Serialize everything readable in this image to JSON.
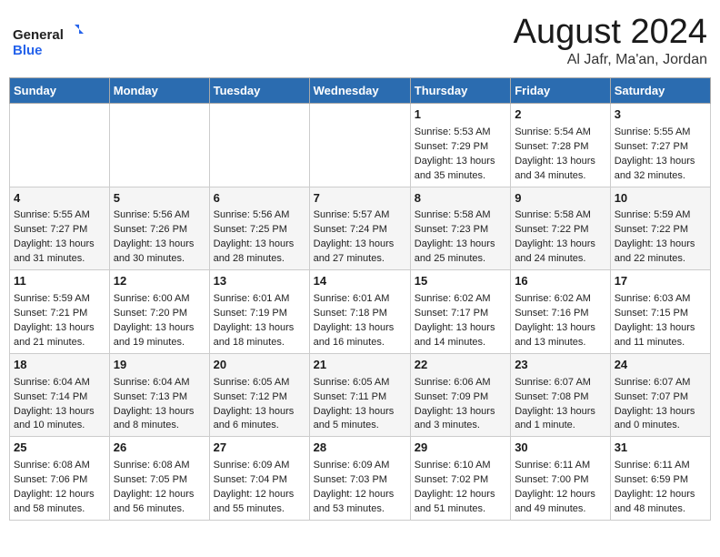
{
  "header": {
    "logo_line1": "General",
    "logo_line2": "Blue",
    "month_year": "August 2024",
    "location": "Al Jafr, Ma'an, Jordan"
  },
  "weekdays": [
    "Sunday",
    "Monday",
    "Tuesday",
    "Wednesday",
    "Thursday",
    "Friday",
    "Saturday"
  ],
  "weeks": [
    [
      {
        "day": "",
        "lines": []
      },
      {
        "day": "",
        "lines": []
      },
      {
        "day": "",
        "lines": []
      },
      {
        "day": "",
        "lines": []
      },
      {
        "day": "1",
        "lines": [
          "Sunrise: 5:53 AM",
          "Sunset: 7:29 PM",
          "Daylight: 13 hours",
          "and 35 minutes."
        ]
      },
      {
        "day": "2",
        "lines": [
          "Sunrise: 5:54 AM",
          "Sunset: 7:28 PM",
          "Daylight: 13 hours",
          "and 34 minutes."
        ]
      },
      {
        "day": "3",
        "lines": [
          "Sunrise: 5:55 AM",
          "Sunset: 7:27 PM",
          "Daylight: 13 hours",
          "and 32 minutes."
        ]
      }
    ],
    [
      {
        "day": "4",
        "lines": [
          "Sunrise: 5:55 AM",
          "Sunset: 7:27 PM",
          "Daylight: 13 hours",
          "and 31 minutes."
        ]
      },
      {
        "day": "5",
        "lines": [
          "Sunrise: 5:56 AM",
          "Sunset: 7:26 PM",
          "Daylight: 13 hours",
          "and 30 minutes."
        ]
      },
      {
        "day": "6",
        "lines": [
          "Sunrise: 5:56 AM",
          "Sunset: 7:25 PM",
          "Daylight: 13 hours",
          "and 28 minutes."
        ]
      },
      {
        "day": "7",
        "lines": [
          "Sunrise: 5:57 AM",
          "Sunset: 7:24 PM",
          "Daylight: 13 hours",
          "and 27 minutes."
        ]
      },
      {
        "day": "8",
        "lines": [
          "Sunrise: 5:58 AM",
          "Sunset: 7:23 PM",
          "Daylight: 13 hours",
          "and 25 minutes."
        ]
      },
      {
        "day": "9",
        "lines": [
          "Sunrise: 5:58 AM",
          "Sunset: 7:22 PM",
          "Daylight: 13 hours",
          "and 24 minutes."
        ]
      },
      {
        "day": "10",
        "lines": [
          "Sunrise: 5:59 AM",
          "Sunset: 7:22 PM",
          "Daylight: 13 hours",
          "and 22 minutes."
        ]
      }
    ],
    [
      {
        "day": "11",
        "lines": [
          "Sunrise: 5:59 AM",
          "Sunset: 7:21 PM",
          "Daylight: 13 hours",
          "and 21 minutes."
        ]
      },
      {
        "day": "12",
        "lines": [
          "Sunrise: 6:00 AM",
          "Sunset: 7:20 PM",
          "Daylight: 13 hours",
          "and 19 minutes."
        ]
      },
      {
        "day": "13",
        "lines": [
          "Sunrise: 6:01 AM",
          "Sunset: 7:19 PM",
          "Daylight: 13 hours",
          "and 18 minutes."
        ]
      },
      {
        "day": "14",
        "lines": [
          "Sunrise: 6:01 AM",
          "Sunset: 7:18 PM",
          "Daylight: 13 hours",
          "and 16 minutes."
        ]
      },
      {
        "day": "15",
        "lines": [
          "Sunrise: 6:02 AM",
          "Sunset: 7:17 PM",
          "Daylight: 13 hours",
          "and 14 minutes."
        ]
      },
      {
        "day": "16",
        "lines": [
          "Sunrise: 6:02 AM",
          "Sunset: 7:16 PM",
          "Daylight: 13 hours",
          "and 13 minutes."
        ]
      },
      {
        "day": "17",
        "lines": [
          "Sunrise: 6:03 AM",
          "Sunset: 7:15 PM",
          "Daylight: 13 hours",
          "and 11 minutes."
        ]
      }
    ],
    [
      {
        "day": "18",
        "lines": [
          "Sunrise: 6:04 AM",
          "Sunset: 7:14 PM",
          "Daylight: 13 hours",
          "and 10 minutes."
        ]
      },
      {
        "day": "19",
        "lines": [
          "Sunrise: 6:04 AM",
          "Sunset: 7:13 PM",
          "Daylight: 13 hours",
          "and 8 minutes."
        ]
      },
      {
        "day": "20",
        "lines": [
          "Sunrise: 6:05 AM",
          "Sunset: 7:12 PM",
          "Daylight: 13 hours",
          "and 6 minutes."
        ]
      },
      {
        "day": "21",
        "lines": [
          "Sunrise: 6:05 AM",
          "Sunset: 7:11 PM",
          "Daylight: 13 hours",
          "and 5 minutes."
        ]
      },
      {
        "day": "22",
        "lines": [
          "Sunrise: 6:06 AM",
          "Sunset: 7:09 PM",
          "Daylight: 13 hours",
          "and 3 minutes."
        ]
      },
      {
        "day": "23",
        "lines": [
          "Sunrise: 6:07 AM",
          "Sunset: 7:08 PM",
          "Daylight: 13 hours",
          "and 1 minute."
        ]
      },
      {
        "day": "24",
        "lines": [
          "Sunrise: 6:07 AM",
          "Sunset: 7:07 PM",
          "Daylight: 13 hours",
          "and 0 minutes."
        ]
      }
    ],
    [
      {
        "day": "25",
        "lines": [
          "Sunrise: 6:08 AM",
          "Sunset: 7:06 PM",
          "Daylight: 12 hours",
          "and 58 minutes."
        ]
      },
      {
        "day": "26",
        "lines": [
          "Sunrise: 6:08 AM",
          "Sunset: 7:05 PM",
          "Daylight: 12 hours",
          "and 56 minutes."
        ]
      },
      {
        "day": "27",
        "lines": [
          "Sunrise: 6:09 AM",
          "Sunset: 7:04 PM",
          "Daylight: 12 hours",
          "and 55 minutes."
        ]
      },
      {
        "day": "28",
        "lines": [
          "Sunrise: 6:09 AM",
          "Sunset: 7:03 PM",
          "Daylight: 12 hours",
          "and 53 minutes."
        ]
      },
      {
        "day": "29",
        "lines": [
          "Sunrise: 6:10 AM",
          "Sunset: 7:02 PM",
          "Daylight: 12 hours",
          "and 51 minutes."
        ]
      },
      {
        "day": "30",
        "lines": [
          "Sunrise: 6:11 AM",
          "Sunset: 7:00 PM",
          "Daylight: 12 hours",
          "and 49 minutes."
        ]
      },
      {
        "day": "31",
        "lines": [
          "Sunrise: 6:11 AM",
          "Sunset: 6:59 PM",
          "Daylight: 12 hours",
          "and 48 minutes."
        ]
      }
    ]
  ]
}
